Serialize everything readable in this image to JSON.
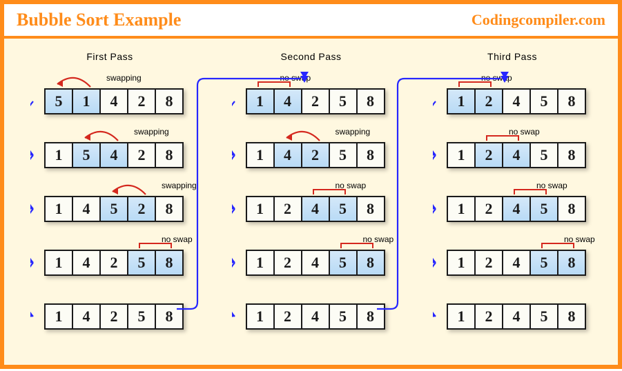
{
  "header": {
    "title": "Bubble Sort Example",
    "site": "Codingcompiler.com"
  },
  "labels": {
    "swap": "swapping",
    "noswap": "no swap"
  },
  "passes": [
    {
      "title": "First  Pass",
      "steps": [
        {
          "vals": [
            5,
            1,
            4,
            2,
            8
          ],
          "hl": [
            0,
            1
          ],
          "action": "swap",
          "label_x": 90
        },
        {
          "vals": [
            1,
            5,
            4,
            2,
            8
          ],
          "hl": [
            1,
            2
          ],
          "action": "swap",
          "label_x": 130
        },
        {
          "vals": [
            1,
            4,
            5,
            2,
            8
          ],
          "hl": [
            2,
            3
          ],
          "action": "swap",
          "label_x": 170
        },
        {
          "vals": [
            1,
            4,
            2,
            5,
            8
          ],
          "hl": [
            3,
            4
          ],
          "action": "noswap",
          "label_x": 170
        },
        {
          "vals": [
            1,
            4,
            2,
            5,
            8
          ],
          "hl": [],
          "action": "none"
        }
      ]
    },
    {
      "title": "Second  Pass",
      "steps": [
        {
          "vals": [
            1,
            4,
            2,
            5,
            8
          ],
          "hl": [
            0,
            1
          ],
          "action": "noswap",
          "label_x": 50
        },
        {
          "vals": [
            1,
            4,
            2,
            5,
            8
          ],
          "hl": [
            1,
            2
          ],
          "action": "swap",
          "label_x": 130
        },
        {
          "vals": [
            1,
            2,
            4,
            5,
            8
          ],
          "hl": [
            2,
            3
          ],
          "action": "noswap",
          "label_x": 130
        },
        {
          "vals": [
            1,
            2,
            4,
            5,
            8
          ],
          "hl": [
            3,
            4
          ],
          "action": "noswap",
          "label_x": 170
        },
        {
          "vals": [
            1,
            2,
            4,
            5,
            8
          ],
          "hl": [],
          "action": "none"
        }
      ]
    },
    {
      "title": "Third  Pass",
      "steps": [
        {
          "vals": [
            1,
            2,
            4,
            5,
            8
          ],
          "hl": [
            0,
            1
          ],
          "action": "noswap",
          "label_x": 50
        },
        {
          "vals": [
            1,
            2,
            4,
            5,
            8
          ],
          "hl": [
            1,
            2
          ],
          "action": "noswap",
          "label_x": 90
        },
        {
          "vals": [
            1,
            2,
            4,
            5,
            8
          ],
          "hl": [
            2,
            3
          ],
          "action": "noswap",
          "label_x": 130
        },
        {
          "vals": [
            1,
            2,
            4,
            5,
            8
          ],
          "hl": [
            3,
            4
          ],
          "action": "noswap",
          "label_x": 170
        },
        {
          "vals": [
            1,
            2,
            4,
            5,
            8
          ],
          "hl": [],
          "action": "none"
        }
      ]
    }
  ]
}
